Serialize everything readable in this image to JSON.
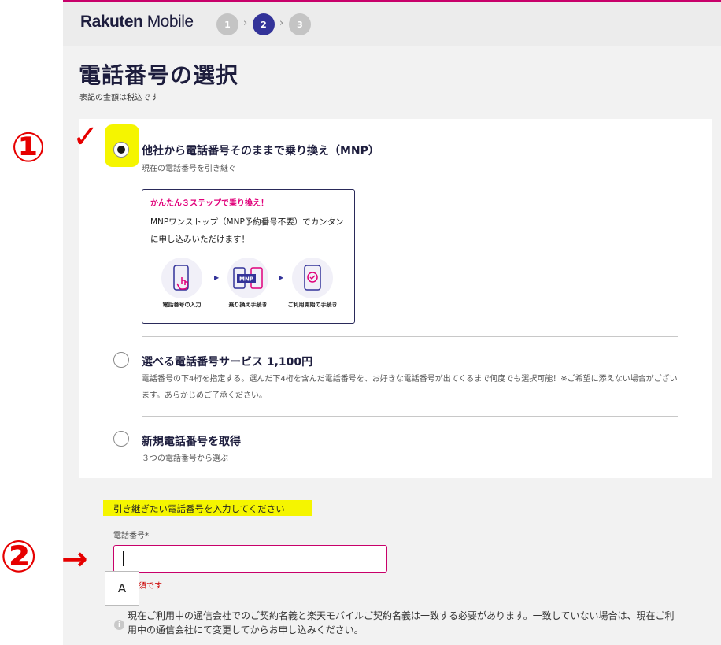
{
  "header": {
    "logo_bold": "Rakuten",
    "logo_rest": " Mobile",
    "steps": [
      "1",
      "2",
      "3"
    ],
    "active_step": 2
  },
  "page": {
    "title": "電話番号の選択",
    "tax_note": "表記の金額は税込です"
  },
  "options": [
    {
      "title": "他社から電話番号そのままで乗り換え（MNP）",
      "desc": "現在の電話番号を引き継ぐ",
      "selected": true,
      "box": {
        "title": "かんたん３ステップで乗り換え！",
        "text": "MNPワンストップ（MNP予約番号不要）でカンタンに申し込みいただけます！",
        "steps": [
          "電話番号の入力",
          "乗り換え手続き",
          "ご利用開始の手続き"
        ],
        "mnp_icon_text": "MNP"
      }
    },
    {
      "title": "選べる電話番号サービス 1,100円",
      "desc": "電話番号の下4桁を指定する。選んだ下4桁を含んだ電話番号を、お好きな電話番号が出てくるまで何度でも選択可能！※ご希望に添えない場合がございます。あらかじめご了承ください。",
      "selected": false
    },
    {
      "title": "新規電話番号を取得",
      "desc": "３つの電話番号から選ぶ",
      "selected": false
    }
  ],
  "phone_form": {
    "section_label": "引き継ぎたい電話番号を入力してください",
    "field_label": "電話番号*",
    "value": "",
    "required_msg": "須です",
    "ime_indicator": "A",
    "info_text": "現在ご利用中の通信会社でのご契約名義と楽天モバイルご契約名義は一致する必要があります。一致していない場合は、現在ご利用中の通信会社にて変更してからお申し込みください。",
    "info_icon": "i"
  },
  "annotations": {
    "mark1": "①",
    "mark2": "②",
    "check": "✓",
    "arrow": "→",
    "color": "#e60000"
  },
  "colors": {
    "brand_magenta": "#c8006a",
    "active_step": "#333399",
    "highlight": "#f5f500"
  }
}
